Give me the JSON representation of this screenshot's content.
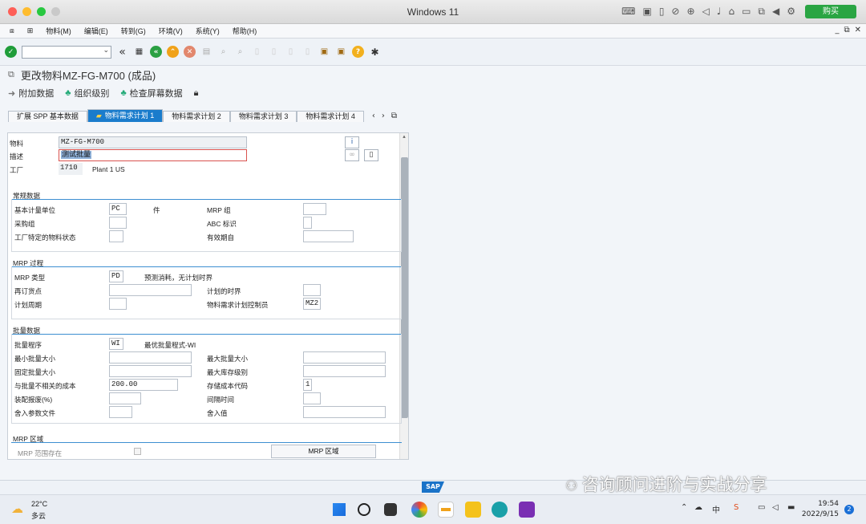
{
  "mac": {
    "title": "Windows 11",
    "buy_label": "购买"
  },
  "menu": [
    "物料(M)",
    "编辑(E)",
    "转到(G)",
    "环境(V)",
    "系统(Y)",
    "帮助(H)"
  ],
  "title": {
    "text": "更改物料",
    "material_bold": "MZ-FG-M700",
    "suffix": "(成品)"
  },
  "app_toolbar": {
    "add_data": "附加数据",
    "org_level": "组织级别",
    "check_screen": "检查屏幕数据"
  },
  "tabs": [
    "扩展 SPP 基本数据",
    "物料需求计划 1",
    "物料需求计划 2",
    "物料需求计划 3",
    "物料需求计划 4"
  ],
  "header": {
    "material_label": "物料",
    "material_value": "MZ-FG-M700",
    "desc_label": "描述",
    "desc_value": "测试批量",
    "plant_label": "工厂",
    "plant_value": "1710",
    "plant_name": "Plant 1 US"
  },
  "general": {
    "title": "常规数据",
    "base_uom_label": "基本计量单位",
    "base_uom_value": "PC",
    "base_uom_text": "件",
    "mrp_group_label": "MRP 组",
    "purch_group_label": "采购组",
    "abc_label": "ABC 标识",
    "plant_status_label": "工厂特定的物料状态",
    "valid_from_label": "有效期自"
  },
  "mrp_process": {
    "title": "MRP 过程",
    "mrp_type_label": "MRP 类型",
    "mrp_type_value": "PD",
    "mrp_type_text": "预测消耗，无计划时界",
    "reorder_label": "再订货点",
    "plan_fence_label": "计划的时界",
    "plan_cycle_label": "计划周期",
    "controller_label": "物料需求计划控制员",
    "controller_value": "MZ2"
  },
  "lot": {
    "title": "批量数据",
    "proc_label": "批量程序",
    "proc_value": "WI",
    "proc_text": "最优批量程式-WI",
    "min_label": "最小批量大小",
    "max_label": "最大批量大小",
    "fixed_label": "固定批量大小",
    "max_stock_label": "最大库存级别",
    "indep_cost_label": "与批量不相关的成本",
    "indep_cost_value": "200.00",
    "storage_code_label": "存储成本代码",
    "storage_code_value": "1",
    "scrap_label": "装配报废(%)",
    "interval_label": "间隔时间",
    "rounding_profile_label": "舍入参数文件",
    "rounding_value_label": "舍入值"
  },
  "mrp_area": {
    "title": "MRP 区域",
    "exists_label": "MRP 范围存在",
    "button": "MRP 区域"
  },
  "watermark": "咨询顾问进阶与实战分享",
  "taskbar": {
    "weather_temp": "22°C",
    "weather_text": "多云",
    "time": "19:54",
    "date": "2022/9/15",
    "badge": "2",
    "ime": "中"
  },
  "colors": {
    "accent": "#1a7ccc",
    "section_line": "#3d8fd1"
  }
}
